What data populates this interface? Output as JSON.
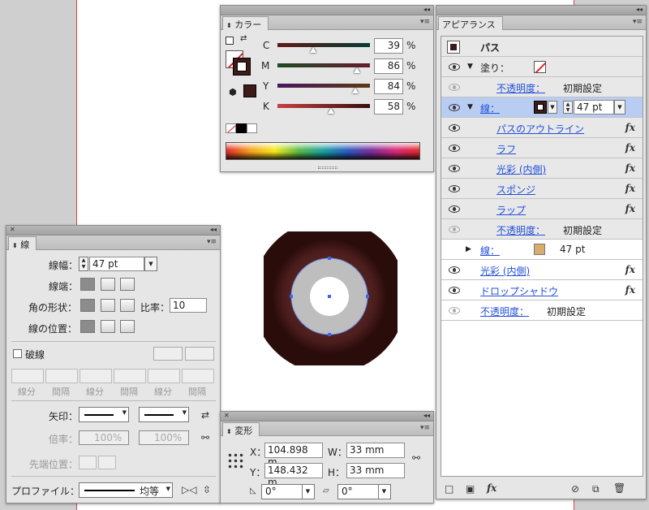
{
  "colors": {
    "donut": "#4a1d1c",
    "stroke_swatch": "#3e1a18",
    "accent": "#2250d8",
    "fill_none": "#d22"
  },
  "color_panel": {
    "title": "カラー",
    "channels": [
      {
        "label": "C",
        "value": "39",
        "unit": "%"
      },
      {
        "label": "M",
        "value": "86",
        "unit": "%"
      },
      {
        "label": "Y",
        "value": "84",
        "unit": "%"
      },
      {
        "label": "K",
        "value": "58",
        "unit": "%"
      }
    ]
  },
  "appearance_panel": {
    "title": "アピアランス",
    "header": "パス",
    "rows": [
      {
        "name": "塗り：",
        "type": "fill"
      },
      {
        "name": "不透明度：",
        "value": "初期設定"
      },
      {
        "name": "線：",
        "value": "47 pt",
        "type": "stroke_selected"
      },
      {
        "name": "パスのアウトライン",
        "fx": "fx"
      },
      {
        "name": "ラフ",
        "fx": "fx"
      },
      {
        "name": "光彩 (内側)",
        "fx": "fx"
      },
      {
        "name": "スポンジ",
        "fx": "fx"
      },
      {
        "name": "ラップ",
        "fx": "fx"
      },
      {
        "name": "不透明度：",
        "value": "初期設定"
      },
      {
        "name": "線：",
        "value": "47 pt"
      },
      {
        "name": "光彩 (内側)",
        "fx": "fx"
      },
      {
        "name": "ドロップシャドウ",
        "fx": "fx"
      },
      {
        "name": "不透明度：",
        "value": "初期設定"
      }
    ]
  },
  "stroke_panel": {
    "title": "線",
    "weight_label": "線幅：",
    "weight_value": "47 pt",
    "cap_label": "線端：",
    "corner_label": "角の形状：",
    "miter_label": "比率：",
    "miter_value": "10",
    "align_label": "線の位置：",
    "dashed_label": "破線",
    "dash_labels": [
      "線分",
      "間隔",
      "線分",
      "間隔",
      "線分",
      "間隔"
    ],
    "arrow_label": "矢印：",
    "scale_label": "倍率：",
    "scale_value1": "100%",
    "scale_value2": "100%",
    "tip_label": "先端位置：",
    "profile_label": "プロファイル：",
    "profile_value": "均等"
  },
  "transform_panel": {
    "title": "変形",
    "x_label": "X：",
    "x_value": "104.898 m",
    "y_label": "Y：",
    "y_value": "148.432 m",
    "w_label": "W：",
    "w_value": "33 mm",
    "h_label": "H：",
    "h_value": "33 mm",
    "rotate_value": "0°",
    "shear_value": "0°"
  }
}
